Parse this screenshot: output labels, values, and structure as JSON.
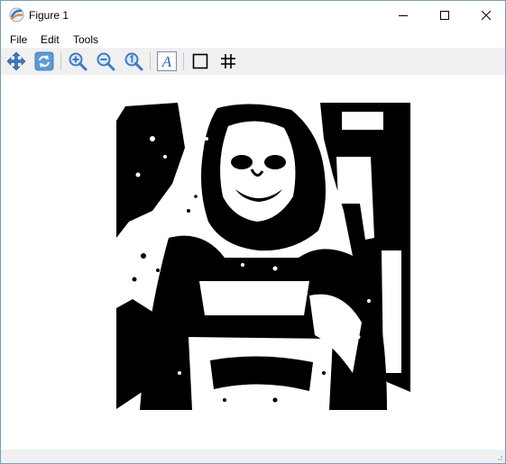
{
  "window": {
    "title": "Figure 1"
  },
  "menu": {
    "items": [
      "File",
      "Edit",
      "Tools"
    ]
  },
  "toolbar": {
    "buttons": [
      "pan-icon",
      "refresh-icon",
      "zoom-in-icon",
      "zoom-out-icon",
      "zoom-reset-icon",
      "text-icon",
      "rectangle-icon",
      "grid-icon"
    ],
    "text_glyph": "A"
  },
  "figure": {
    "content": "black-and-white thresholded photograph"
  },
  "colors": {
    "window_border": "#7a9bbf",
    "toolbar_bg": "#f0f0f0",
    "icon_blue": "#3a7bc8"
  }
}
